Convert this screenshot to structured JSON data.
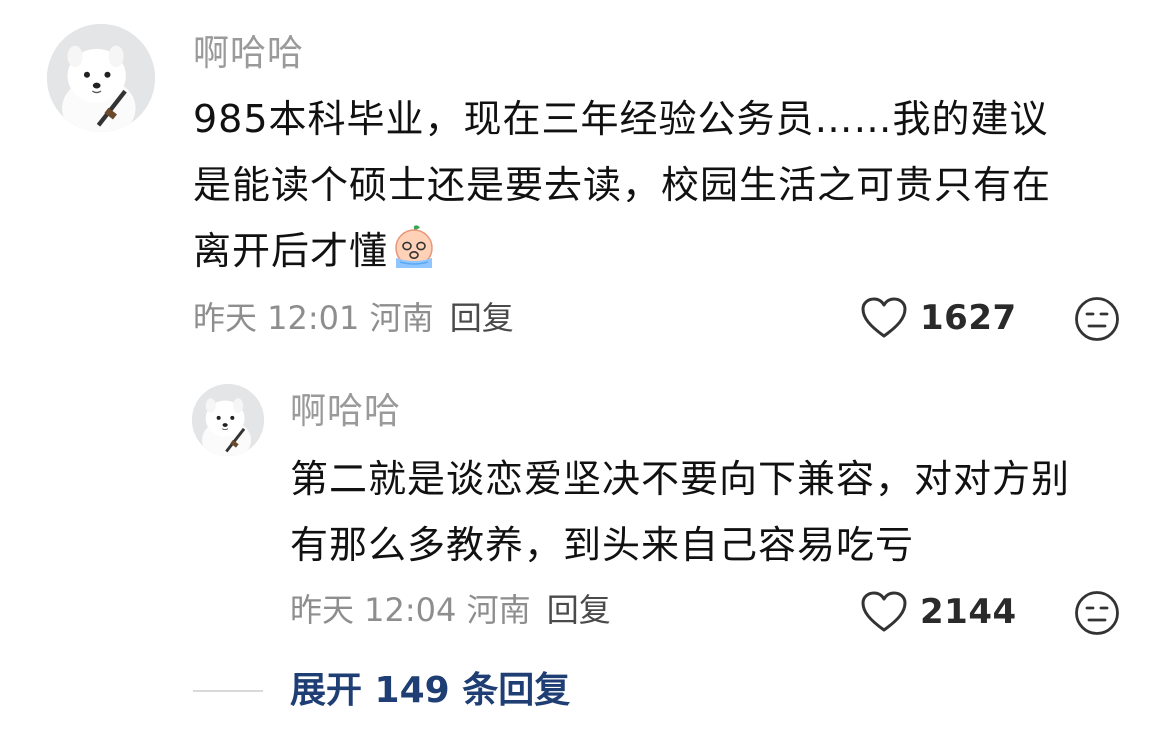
{
  "comment": {
    "username": "啊哈哈",
    "lines": [
      "985本科毕业，现在三年经验公务员……我的建议",
      "是能读个硕士还是要去读，校园生活之可贵只有在",
      "离开后才懂"
    ],
    "emoji": "crying-face-emoji",
    "time": "昨天 12:01",
    "location": "河南",
    "reply_label": "回复",
    "likes": "1627"
  },
  "reply": {
    "username": "啊哈哈",
    "lines": [
      "第二就是谈恋爱坚决不要向下兼容，对对方别",
      "有那么多教养，到头来自己容易吃亏"
    ],
    "time": "昨天 12:04",
    "location": "河南",
    "reply_label": "回复",
    "likes": "2144"
  },
  "expand_label": "展开 149 条回复",
  "icons": {
    "like": "heart-outline-icon",
    "dislike": "meh-face-icon",
    "avatar": "samoyed-dog-avatar"
  }
}
